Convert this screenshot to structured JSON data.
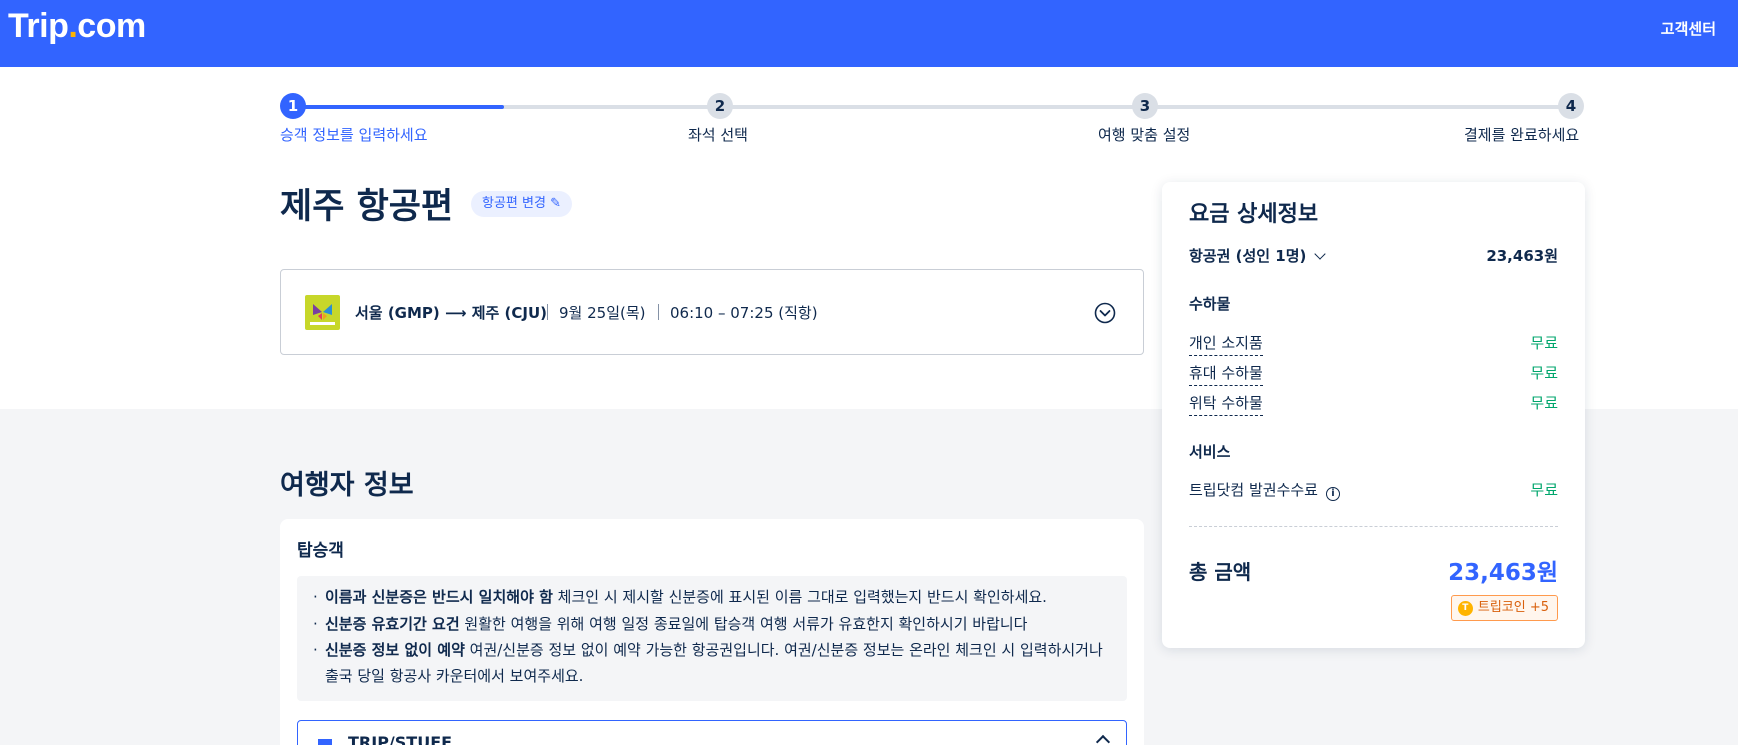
{
  "header": {
    "logo_main": "Trip",
    "logo_dot": ".",
    "logo_tail": "com",
    "support_label": "고객센터"
  },
  "colors": {
    "brand": "#3264ff",
    "free": "#00a66c",
    "coin": "#ffb400"
  },
  "stepper": {
    "progress_fraction": 0.16,
    "steps": [
      {
        "number": "1",
        "label": "승객 정보를 입력하세요",
        "active": true
      },
      {
        "number": "2",
        "label": "좌석 선택",
        "active": false
      },
      {
        "number": "3",
        "label": "여행 맞춤 설정",
        "active": false
      },
      {
        "number": "4",
        "label": "결제를 완료하세요",
        "active": false
      }
    ]
  },
  "page": {
    "title": "제주 항공편",
    "change_flight_label": "항공편 변경 ✎"
  },
  "flight": {
    "airline_logo_icon": "jinair-logo",
    "route": "서울 (GMP) ⟶ 제주 (CJU)",
    "date": "9월 25일(목)",
    "time": "06:10 – 07:25 (직항)",
    "expand_icon": "chevron-down-circle-icon"
  },
  "traveler": {
    "section_title": "여행자 정보",
    "card_title": "탑승객",
    "notices": [
      {
        "bold": "이름과 신분증은 반드시 일치해야 함",
        "text": " 체크인 시 제시할 신분증에 표시된 이름 그대로 입력했는지 반드시 확인하세요."
      },
      {
        "bold": "신분증 유효기간 요건",
        "text": " 원활한 여행을 위해 여행 일정 종료일에 탑승객 여행 서류가 유효한지 확인하시기 바랍니다"
      },
      {
        "bold": "신분증 정보 없이 예약",
        "text": " 여권/신분증 정보 없이 예약 가능한 항공권입니다. 여권/신분증 정보는 온라인 체크인 시 입력하시거나 출국 당일 항공사 카운터에서 보여주세요."
      }
    ],
    "passenger_name": "TRIP/STUFF"
  },
  "fare": {
    "title": "요금 상세정보",
    "ticket_label": "항공권 (성인 1명)",
    "ticket_price": "23,463원",
    "baggage_heading": "수하물",
    "baggage": [
      {
        "label": "개인 소지품",
        "value": "무료"
      },
      {
        "label": "휴대 수하물",
        "value": "무료"
      },
      {
        "label": "위탁 수하물",
        "value": "무료"
      }
    ],
    "service_heading": "서비스",
    "service_label": "트립닷컴 발권수수료",
    "service_value": "무료",
    "total_label": "총 금액",
    "total_value": "23,463원",
    "coin_icon_letter": "T",
    "coin_label": "트립코인 +5"
  }
}
